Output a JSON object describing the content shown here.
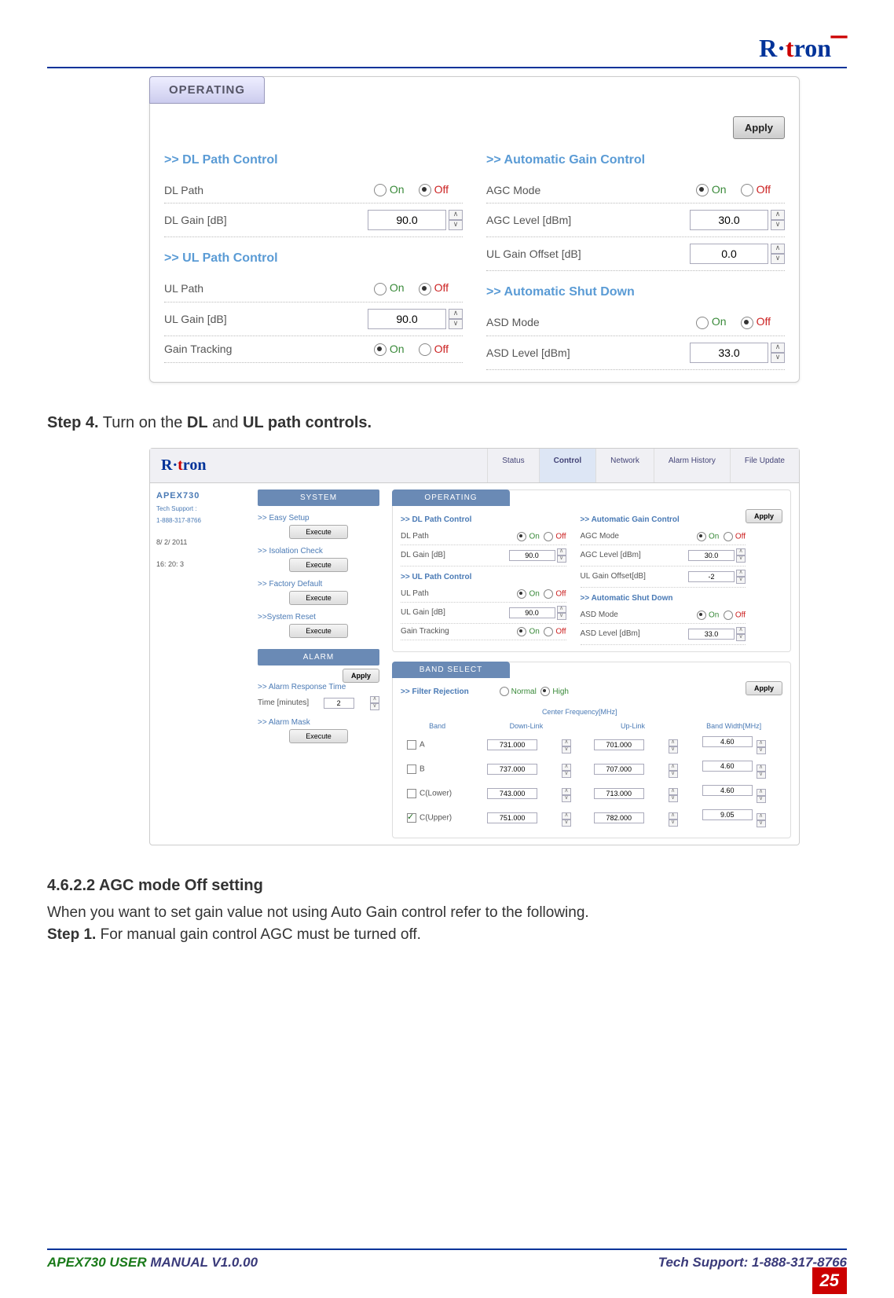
{
  "header": {
    "brand_prefix": "R·",
    "brand_rest": "tron"
  },
  "panel1": {
    "tab": "OPERATING",
    "apply": "Apply",
    "dl": {
      "hdr": ">> DL Path Control",
      "path": "DL Path",
      "on": "On",
      "off": "Off",
      "gain": "DL Gain [dB]",
      "gain_v": "90.0"
    },
    "ul": {
      "hdr": ">> UL Path Control",
      "path": "UL Path",
      "on": "On",
      "off": "Off",
      "gain": "UL Gain [dB]",
      "gain_v": "90.0",
      "track": "Gain Tracking"
    },
    "agc": {
      "hdr": ">> Automatic Gain Control",
      "mode": "AGC Mode",
      "on": "On",
      "off": "Off",
      "level": "AGC Level [dBm]",
      "level_v": "30.0",
      "uloff": "UL Gain Offset [dB]",
      "uloff_v": "0.0"
    },
    "asd": {
      "hdr": ">> Automatic Shut Down",
      "mode": "ASD Mode",
      "on": "On",
      "off": "Off",
      "level": "ASD Level [dBm]",
      "level_v": "33.0"
    }
  },
  "step4": {
    "bold1": "Step 4.",
    "txt": " Turn on the ",
    "bold2": "DL",
    "txt2": " and ",
    "bold3": "UL path controls."
  },
  "shot2": {
    "tabs": {
      "status": "Status",
      "control": "Control",
      "network": "Network",
      "alarm": "Alarm History",
      "file": "File Update"
    },
    "side": {
      "name": "APEX730",
      "tech1": "Tech Support :",
      "tech2": "1-888-317-8766",
      "d": "8/   2/   2011",
      "t": "16:   20:    3"
    },
    "mid": {
      "sys": "SYSTEM",
      "easy": ">> Easy Setup",
      "iso": ">> Isolation Check",
      "fac": ">> Factory Default",
      "rst": ">>System Reset",
      "exe": "Execute",
      "alm": "ALARM",
      "apply": "Apply",
      "art": ">> Alarm Response Time",
      "tm": "Time [minutes]",
      "tm_v": "2",
      "mask": ">> Alarm Mask"
    },
    "op": {
      "tab": "OPERATING",
      "apply": "Apply",
      "dlhdr": ">> DL Path Control",
      "dlpath": "DL Path",
      "on": "On",
      "off": "Off",
      "dlgain": "DL Gain [dB]",
      "dlgain_v": "90.0",
      "ulhdr": ">> UL Path Control",
      "ulpath": "UL Path",
      "ulgain": "UL Gain [dB]",
      "ulgain_v": "90.0",
      "track": "Gain Tracking",
      "agchdr": ">> Automatic Gain Control",
      "agcmode": "AGC Mode",
      "agclvl": "AGC Level [dBm]",
      "agclvl_v": "30.0",
      "uloff": "UL Gain Offset[dB]",
      "uloff_v": "-2",
      "asdhdr": ">> Automatic Shut Down",
      "asdmode": "ASD Mode",
      "asdlvl": "ASD Level [dBm]",
      "asdlvl_v": "33.0"
    },
    "band": {
      "hdr": "BAND SELECT",
      "apply": "Apply",
      "filt": ">> Filter Rejection",
      "norm": "Normal",
      "high": "High",
      "cfreq": "Center Frequency[MHz]",
      "band": "Band",
      "dl": "Down-Link",
      "ul": "Up-Link",
      "bw": "Band Width[MHz]",
      "rows": [
        {
          "n": "A",
          "dl": "731.000",
          "ul": "701.000",
          "bw": "4.60",
          "chk": false
        },
        {
          "n": "B",
          "dl": "737.000",
          "ul": "707.000",
          "bw": "4.60",
          "chk": false
        },
        {
          "n": "C(Lower)",
          "dl": "743.000",
          "ul": "713.000",
          "bw": "4.60",
          "chk": false
        },
        {
          "n": "C(Upper)",
          "dl": "751.000",
          "ul": "782.000",
          "bw": "9.05",
          "chk": true
        }
      ]
    }
  },
  "s462": {
    "h": "4.6.2.2 AGC mode Off setting",
    "p1": "When you want to set gain value not using Auto Gain control refer to the following.",
    "p2a": "Step 1.",
    "p2b": " For manual gain control AGC must be turned off."
  },
  "footer": {
    "l1": "APEX730 USER",
    "l2": " MANUAL V1.0.00",
    "r": "Tech Support: 1-888-317-8766",
    "page": "25"
  }
}
